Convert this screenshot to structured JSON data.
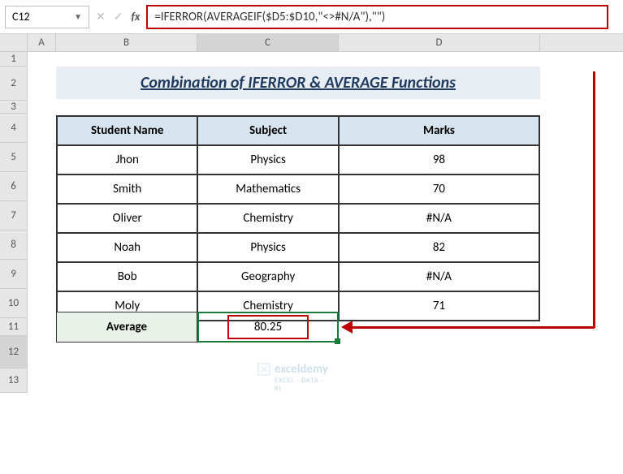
{
  "nameBox": {
    "value": "C12"
  },
  "formulaBar": {
    "formula": "=IFERROR(AVERAGEIF($D5:$D10,\"<>#N/A\"),\"\")"
  },
  "columns": [
    "A",
    "B",
    "C",
    "D"
  ],
  "rows": [
    "1",
    "2",
    "3",
    "4",
    "5",
    "6",
    "7",
    "8",
    "9",
    "10",
    "11",
    "12",
    "13"
  ],
  "title": "Combination of IFERROR & AVERAGE Functions",
  "table": {
    "headers": {
      "b": "Student Name",
      "c": "Subject",
      "d": "Marks"
    },
    "rows": [
      {
        "b": "Jhon",
        "c": "Physics",
        "d": "98"
      },
      {
        "b": "Smith",
        "c": "Mathematics",
        "d": "70"
      },
      {
        "b": "Oliver",
        "c": "Chemistry",
        "d": "#N/A"
      },
      {
        "b": "Noah",
        "c": "Physics",
        "d": "82"
      },
      {
        "b": "Bob",
        "c": "Geography",
        "d": "#N/A"
      },
      {
        "b": "Moly",
        "c": "Chemistry",
        "d": "71"
      }
    ]
  },
  "average": {
    "label": "Average",
    "value": "80.25"
  },
  "watermark": {
    "text": "exceldemy",
    "sub": "EXCEL · DATA · BI"
  },
  "icons": {
    "dropdown": "▼",
    "cancel": "✕",
    "confirm": "✓",
    "fx": "fx"
  }
}
